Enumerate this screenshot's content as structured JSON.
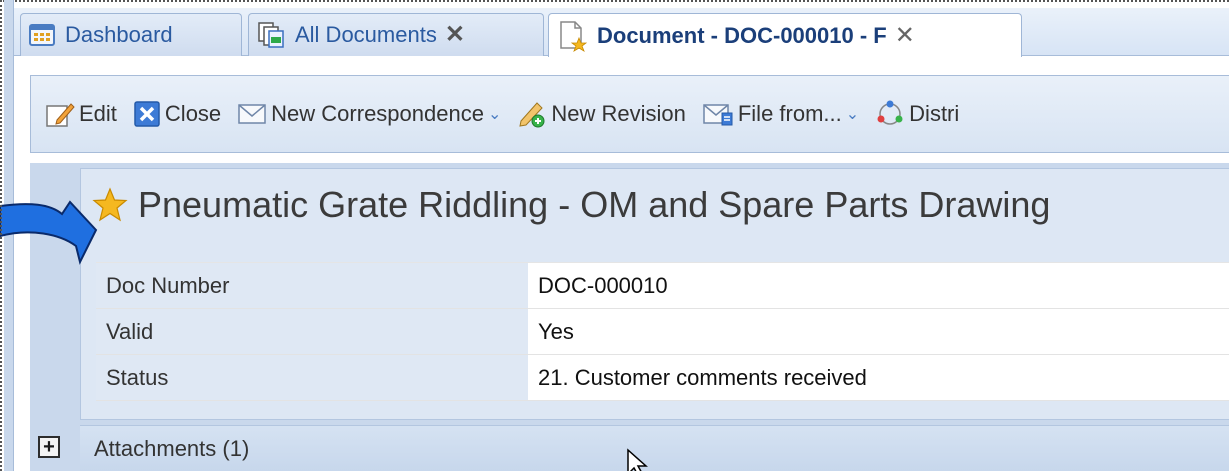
{
  "tabs": [
    {
      "label": "Dashboard",
      "icon": "dashboard-icon",
      "closable": false,
      "active": false
    },
    {
      "label": "All Documents",
      "icon": "documents-icon",
      "closable": true,
      "active": false
    },
    {
      "label": "Document - DOC-000010 - F",
      "icon": "document-star-icon",
      "closable": true,
      "active": true
    }
  ],
  "toolbar": {
    "edit_label": "Edit",
    "close_label": "Close",
    "new_correspondence_label": "New Correspondence",
    "new_revision_label": "New Revision",
    "file_from_label": "File from...",
    "distribute_label": "Distri"
  },
  "document": {
    "title": "Pneumatic Grate Riddling - OM and Spare Parts Drawing",
    "fields": [
      {
        "label": "Doc Number",
        "value": "DOC-000010"
      },
      {
        "label": "Valid",
        "value": "Yes"
      },
      {
        "label": "Status",
        "value": "21. Customer comments received"
      }
    ]
  },
  "attachments": {
    "label": "Attachments (1)"
  },
  "colors": {
    "accent": "#2a5aa0",
    "toolbar_bg": "#d8e4f3",
    "panel_bg": "#c9d8ec",
    "callout_arrow": "#1f6fe0"
  }
}
